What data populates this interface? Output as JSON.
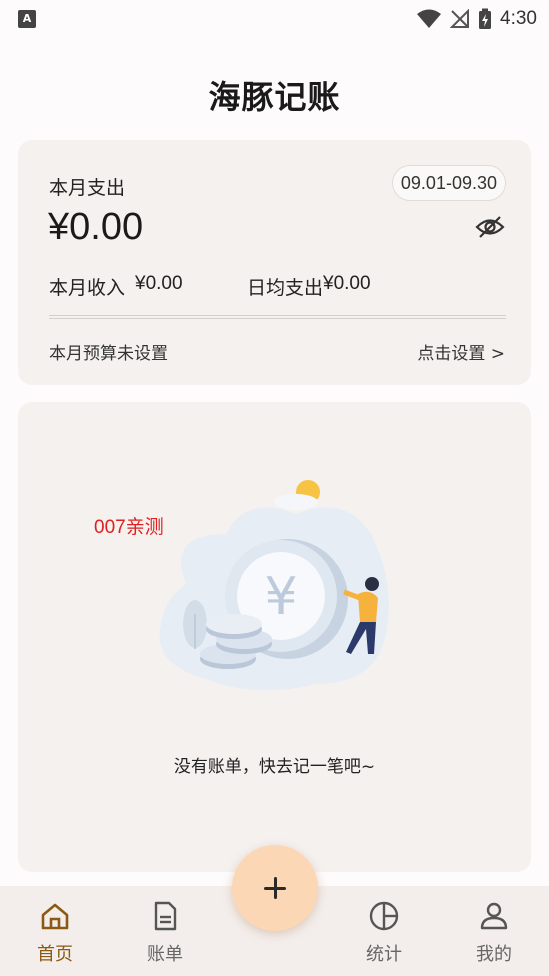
{
  "status_bar": {
    "app_icon": "A",
    "time": "4:30",
    "icons": [
      "wifi-icon",
      "no-signal-icon",
      "battery-charging-icon"
    ]
  },
  "header": {
    "title": "海豚记账"
  },
  "summary": {
    "label": "本月支出",
    "date_range": "09.01-09.30",
    "amount": "¥0.00",
    "income_label": "本月收入",
    "income_value": "¥0.00",
    "daily_label": "日均支出",
    "daily_value": "¥0.00",
    "budget_label": "本月预算未设置",
    "budget_link": "点击设置 >"
  },
  "empty_state": {
    "watermark": "007亲测",
    "message": "没有账单，快去记一笔吧~",
    "illustration": "coin-person-illustration"
  },
  "fab": {
    "icon": "plus-icon"
  },
  "bottom_nav": {
    "items": [
      {
        "label": "首页",
        "icon": "home-icon",
        "active": true
      },
      {
        "label": "账单",
        "icon": "document-icon",
        "active": false
      },
      {
        "label": "统计",
        "icon": "pie-chart-icon",
        "active": false
      },
      {
        "label": "我的",
        "icon": "user-icon",
        "active": false
      }
    ]
  },
  "colors": {
    "accent": "#8b5a12",
    "fab": "#fbd7b5",
    "card": "#f5f1ef",
    "watermark": "#e02020"
  }
}
